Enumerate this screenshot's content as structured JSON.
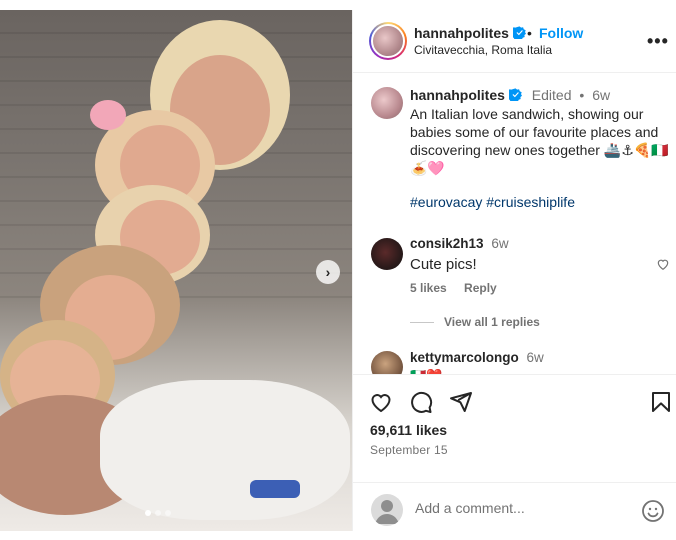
{
  "post": {
    "image_alt": "",
    "carousel_dots": 3
  },
  "header": {
    "username": "hannahpolites",
    "separator": "•",
    "follow_label": "Follow",
    "location": "Civitavecchia, Roma Italia",
    "more_icon": "more-horizontal-icon"
  },
  "caption": {
    "username": "hannahpolites",
    "edited": "Edited",
    "dot": "•",
    "age": "6w",
    "text": "An Italian love sandwich, showing our babies some of our favourite places and discovering new ones together 🚢⚓🍕🇮🇹🍝🩷",
    "hashtags": "#eurovacay #cruiseshiplife"
  },
  "comments": [
    {
      "username": "consik2h13",
      "age": "6w",
      "text": "Cute pics!",
      "likes": "5 likes",
      "reply": "Reply",
      "view_replies": "View all 1 replies"
    },
    {
      "username": "kettymarcolongo",
      "age": "6w",
      "text": "🇮🇹❤️"
    }
  ],
  "actions": {
    "likes": "69,611 likes",
    "date": "September 15",
    "add_comment_placeholder": "Add a comment..."
  },
  "colors": {
    "accent": "#0095f6",
    "hashtag": "#00376b",
    "muted": "#737373"
  }
}
